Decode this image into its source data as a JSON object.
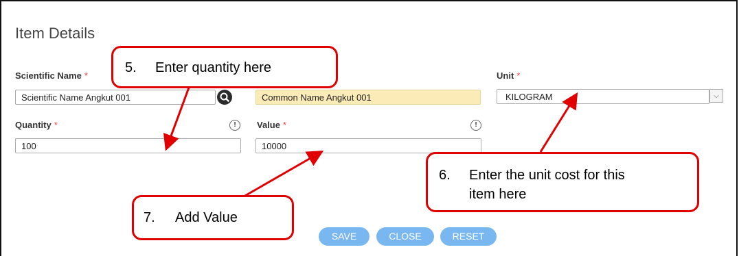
{
  "section_title": "Item Details",
  "fields": {
    "scientific_name": {
      "label": "Scientific Name",
      "required_mark": "*",
      "value": "Scientific Name Angkut 001"
    },
    "common_name": {
      "value": "Common Name Angkut 001"
    },
    "unit": {
      "label": "Unit",
      "required_mark": "*",
      "value": "KILOGRAM"
    },
    "quantity": {
      "label": "Quantity",
      "required_mark": "*",
      "value": "100"
    },
    "value": {
      "label": "Value",
      "required_mark": "*",
      "value": "10000"
    }
  },
  "info_glyph": "!",
  "buttons": {
    "save": "SAVE",
    "close": "CLOSE",
    "reset": "RESET"
  },
  "callouts": {
    "quantity": {
      "number": "5.",
      "text": "Enter quantity here"
    },
    "unit": {
      "number": "6.",
      "line1": "Enter the unit cost for this",
      "line2": "item here"
    },
    "value": {
      "number": "7.",
      "text": "Add Value"
    }
  },
  "colors": {
    "required": "#ee4444",
    "callout_border": "#e00000",
    "button": "#79b7f0",
    "highlight_field": "#fbebb7"
  },
  "icons": {
    "search": "search-icon",
    "dropdown": "chevron-down-icon",
    "info": "info-icon"
  }
}
